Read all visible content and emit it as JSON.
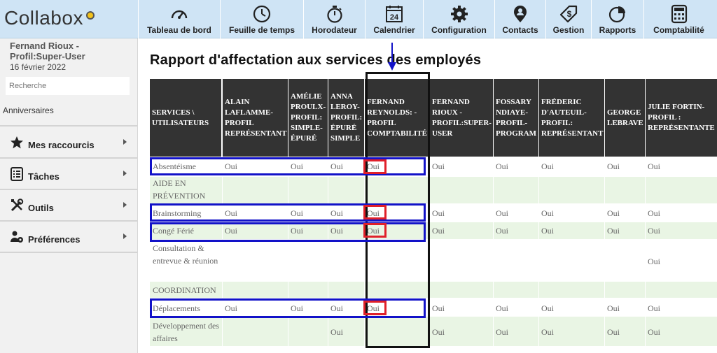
{
  "app": {
    "logo": "Collabox"
  },
  "nav": [
    {
      "label": "Tableau de bord",
      "icon": "gauge-icon"
    },
    {
      "label": "Feuille de temps",
      "icon": "clock-icon"
    },
    {
      "label": "Horodateur",
      "icon": "stopwatch-icon"
    },
    {
      "label": "Calendrier",
      "icon": "calendar-icon",
      "day": "24"
    },
    {
      "label": "Configuration",
      "icon": "gear-icon"
    },
    {
      "label": "Contacts",
      "icon": "person-pin-icon"
    },
    {
      "label": "Gestion",
      "icon": "dollar-tag-icon"
    },
    {
      "label": "Rapports",
      "icon": "pie-chart-icon"
    },
    {
      "label": "Comptabilité",
      "icon": "calculator-icon"
    }
  ],
  "sidebar": {
    "user_name": "Fernand Rioux - Profil:Super-User",
    "date": "16 février 2022",
    "search_placeholder": "Recherche",
    "anniversaires": "Anniversaires",
    "items": [
      {
        "label": "Mes raccourcis",
        "icon": "star-icon"
      },
      {
        "label": "Tâches",
        "icon": "checklist-icon"
      },
      {
        "label": "Outils",
        "icon": "tools-icon"
      },
      {
        "label": "Préférences",
        "icon": "user-settings-icon"
      }
    ]
  },
  "report": {
    "title": "Rapport d'affectation aux services des employés",
    "corner_header": "SERVICES \\ UTILISATEURS",
    "columns": [
      "ALAIN LAFLAMME- PROFIL REPRÉSENTANT",
      "AMÉLIE PROULX- PROFIL: SIMPLE- ÉPURÉ",
      "ANNA LEROY- PROFIL: ÉPURÉ SIMPLE",
      "FERNAND REYNOLDS: - PROFIL COMPTABILITÉ",
      "FERNAND RIOUX - PROFIL:SUPER- USER",
      "FOSSARY NDIAYE- PROFIL- PROGRAM",
      "FRÉDERIC D'AUTEUIL- PROFIL: REPRÉSENTANT",
      "GEORGE LEBRAVE",
      "JULIE FORTIN- PROFIL : REPRÉSENTANTE"
    ],
    "rows": [
      {
        "label": "Absentéisme",
        "cells": [
          "Oui",
          "Oui",
          "Oui",
          "Oui",
          "Oui",
          "Oui",
          "Oui",
          "Oui",
          "Oui"
        ]
      },
      {
        "label": "AIDE EN PRÉVENTION",
        "cells": [
          "",
          "",
          "",
          "",
          "",
          "",
          "",
          "",
          ""
        ]
      },
      {
        "label": "Brainstorming",
        "cells": [
          "Oui",
          "Oui",
          "Oui",
          "Oui",
          "Oui",
          "Oui",
          "Oui",
          "Oui",
          "Oui"
        ]
      },
      {
        "label": "Congé Férié",
        "cells": [
          "Oui",
          "Oui",
          "Oui",
          "Oui",
          "Oui",
          "Oui",
          "Oui",
          "Oui",
          "Oui"
        ]
      },
      {
        "label": "Consultation & entrevue & réunion",
        "cells": [
          "",
          "",
          "",
          "",
          "",
          "",
          "",
          "",
          "Oui"
        ]
      },
      {
        "label": "COORDINATION",
        "cells": [
          "",
          "",
          "",
          "",
          "",
          "",
          "",
          "",
          ""
        ]
      },
      {
        "label": "Déplacements",
        "cells": [
          "Oui",
          "Oui",
          "Oui",
          "Oui",
          "Oui",
          "Oui",
          "Oui",
          "Oui",
          "Oui"
        ]
      },
      {
        "label": "Développement des affaires",
        "cells": [
          "",
          "",
          "Oui",
          "",
          "Oui",
          "Oui",
          "Oui",
          "Oui",
          "Oui"
        ]
      }
    ]
  }
}
